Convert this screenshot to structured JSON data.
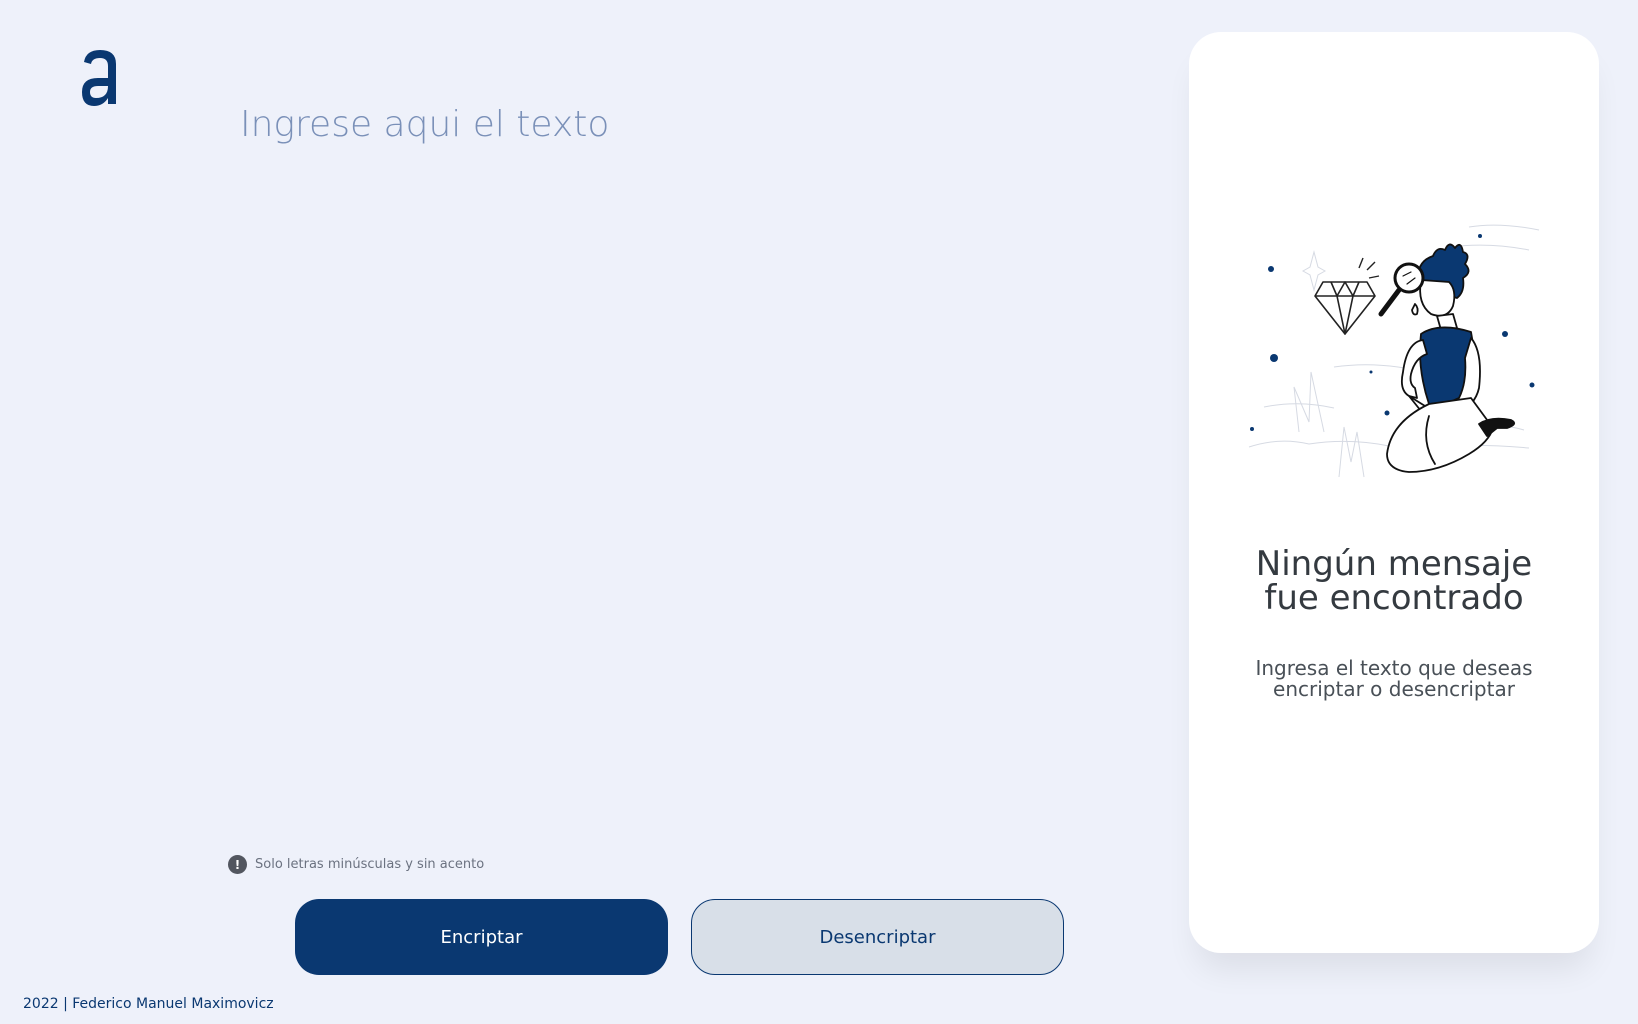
{
  "logo": {
    "letter": "a",
    "color": "#0a3871",
    "icon": "alura-logo-icon"
  },
  "input": {
    "placeholder": "Ingrese aqui el texto",
    "value": ""
  },
  "hint": {
    "icon": "exclamation-circle-icon",
    "glyph": "!",
    "text": "Solo letras minúsculas y sin acento"
  },
  "buttons": {
    "encrypt_label": "Encriptar",
    "decrypt_label": "Desencriptar"
  },
  "footer": {
    "text": "2022 | Federico Manuel Maximovicz"
  },
  "output_panel": {
    "illustration": "person-with-magnifying-glass-and-diamond",
    "title_line1": "Ningún mensaje",
    "title_line2": "fue encontrado",
    "subtitle_line1": "Ingresa el texto que deseas",
    "subtitle_line2": "encriptar o desencriptar"
  },
  "colors": {
    "primary": "#0a3871",
    "background": "#eef1fa",
    "card": "#ffffff",
    "secondary_button": "#d8dfe8"
  }
}
